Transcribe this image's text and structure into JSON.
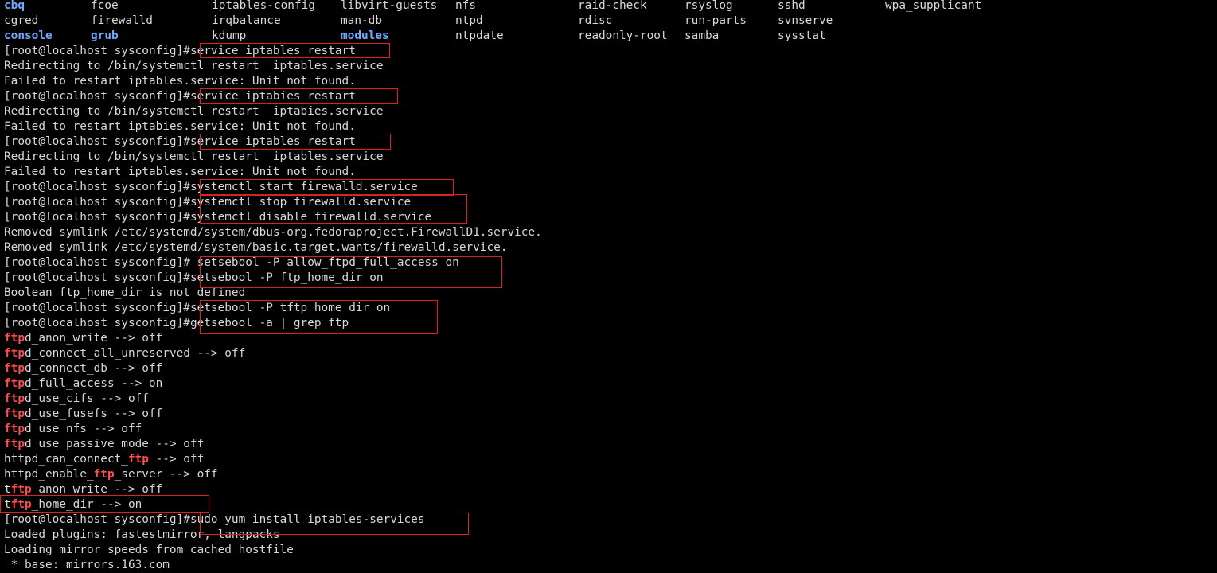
{
  "listing": {
    "row1": [
      {
        "text": "cbq",
        "kind": "dir"
      },
      {
        "text": "fcoe",
        "kind": "file"
      },
      {
        "text": "iptables-config",
        "kind": "file"
      },
      {
        "text": "libvirt-guests",
        "kind": "file"
      },
      {
        "text": "nfs",
        "kind": "file"
      },
      {
        "text": "raid-check",
        "kind": "file"
      },
      {
        "text": "rsyslog",
        "kind": "file"
      },
      {
        "text": "sshd",
        "kind": "file"
      },
      {
        "text": "wpa_supplicant",
        "kind": "file"
      }
    ],
    "row2": [
      {
        "text": "cgred",
        "kind": "file"
      },
      {
        "text": "firewalld",
        "kind": "file"
      },
      {
        "text": "irqbalance",
        "kind": "file"
      },
      {
        "text": "man-db",
        "kind": "file"
      },
      {
        "text": "ntpd",
        "kind": "file"
      },
      {
        "text": "rdisc",
        "kind": "file"
      },
      {
        "text": "run-parts",
        "kind": "file"
      },
      {
        "text": "svnserve",
        "kind": "file"
      }
    ],
    "row3": [
      {
        "text": "console",
        "kind": "dir"
      },
      {
        "text": "grub",
        "kind": "dir"
      },
      {
        "text": "kdump",
        "kind": "file"
      },
      {
        "text": "modules",
        "kind": "dir"
      },
      {
        "text": "ntpdate",
        "kind": "file"
      },
      {
        "text": "readonly-root",
        "kind": "file"
      },
      {
        "text": "samba",
        "kind": "file"
      },
      {
        "text": "sysstat",
        "kind": "file"
      }
    ]
  },
  "prompt": "[root@localhost sysconfig]#",
  "lines": {
    "l3": "service iptables restart",
    "l4": "Redirecting to /bin/systemctl restart  iptables.service",
    "l5": "Failed to restart iptables.service: Unit not found.",
    "l6": "service iptabies restart",
    "l7": "Redirecting to /bin/systemctl restart  iptabies.service",
    "l8": "Failed to restart iptabies.service: Unit not found.",
    "l9": "service iptables restart",
    "l10": "Redirecting to /bin/systemctl restart  iptables.service",
    "l11": "Failed to restart iptables.service: Unit not found.",
    "l12": "systemctl start firewalld.service",
    "l13": "systemctl stop firewalld.service",
    "l14": "systemctl disable firewalld.service",
    "l15": "Removed symlink /etc/systemd/system/dbus-org.fedoraproject.FirewallD1.service.",
    "l16": "Removed symlink /etc/systemd/system/basic.target.wants/firewalld.service.",
    "l17": " setsebool -P allow_ftpd_full_access on",
    "l18": "setsebool -P ftp_home_dir on",
    "l19": "Boolean ftp_home_dir is not defined",
    "l20": "setsebool -P tftp_home_dir on",
    "l21": "getsebool -a | grep ftp",
    "l34": "sudo yum install iptables-services",
    "l35": "Loaded plugins: fastestmirror, langpacks",
    "l36": "Loading mirror speeds from cached hostfile",
    "l37": " * base: mirrors.163.com"
  },
  "sebool": [
    {
      "pre": "",
      "hl": "ftp",
      "post": "d_anon_write --> off"
    },
    {
      "pre": "",
      "hl": "ftp",
      "post": "d_connect_all_unreserved --> off"
    },
    {
      "pre": "",
      "hl": "ftp",
      "post": "d_connect_db --> off"
    },
    {
      "pre": "",
      "hl": "ftp",
      "post": "d_full_access --> on"
    },
    {
      "pre": "",
      "hl": "ftp",
      "post": "d_use_cifs --> off"
    },
    {
      "pre": "",
      "hl": "ftp",
      "post": "d_use_fusefs --> off"
    },
    {
      "pre": "",
      "hl": "ftp",
      "post": "d_use_nfs --> off"
    },
    {
      "pre": "",
      "hl": "ftp",
      "post": "d_use_passive_mode --> off"
    },
    {
      "pre": "httpd_can_connect_",
      "hl": "ftp",
      "post": " --> off"
    },
    {
      "pre": "httpd_enable_",
      "hl": "ftp",
      "post": "_server --> off"
    },
    {
      "pre": "t",
      "hl": "ftp",
      "post": "_anon_write --> off"
    },
    {
      "pre": "t",
      "hl": "ftp",
      "post": "_home_dir --> on"
    }
  ],
  "colors": {
    "background": "#000000",
    "text": "#d8d8d8",
    "directory": "#6fa8ff",
    "grep_match": "#ff4d4d",
    "annotation_box": "#e02020"
  }
}
